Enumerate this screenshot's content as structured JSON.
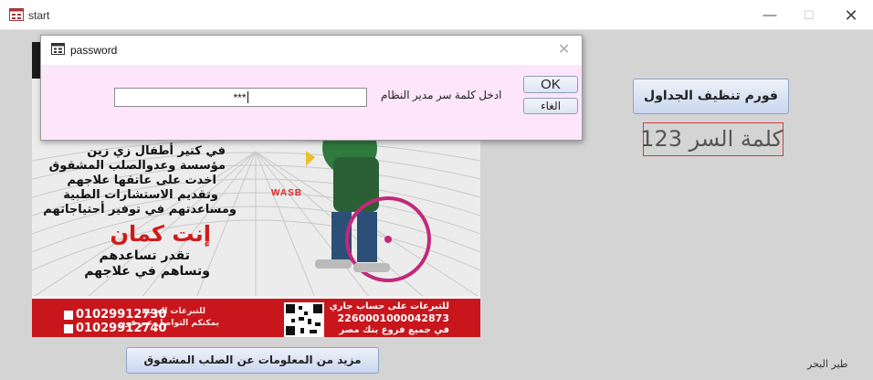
{
  "window": {
    "title": "start",
    "minimize": "—",
    "maximize": "☐",
    "close": "✕"
  },
  "dialog": {
    "title": "password",
    "close": "✕",
    "input_value": "***",
    "label": "ادخل كلمة سر مدير النظام",
    "ok_label": "OK",
    "cancel_label": "الغاء"
  },
  "poster": {
    "lines": [
      "في كتير أطفال زي زين",
      "مؤسسة وعدوالصلب المشقوق",
      "اخدت على عاتقها علاجهم",
      "وتقديم الاستشارات الطبية",
      "ومساعدتهم في توفير أحتياجاتهم"
    ],
    "headline": "إنت كمان",
    "subline1": "تقدر تساعدهم",
    "subline2": "وتساهم في علاجهم",
    "logo": "WASB",
    "donate_account_title": "للتبرعات على حساب جاري",
    "account_number": "2260001000042873",
    "branches": "في جميع فروع بنك مصر",
    "inkind_title": "للتبرعات العينية",
    "inkind_contact": "يمكنكم التواصل عبر فون",
    "phone1": "01029912730",
    "phone2": "01029912740"
  },
  "buttons": {
    "clean_tables": "فورم تنظيف الجداول",
    "more_info": "مزيد من المعلومات عن الصلب المشقوق"
  },
  "password_hint": "كلمة السر 123",
  "author": "طير البحر",
  "colors": {
    "accent_red": "#c8161c",
    "dialog_bg": "#fde6fb",
    "button_blue": "#c9d6ee"
  }
}
